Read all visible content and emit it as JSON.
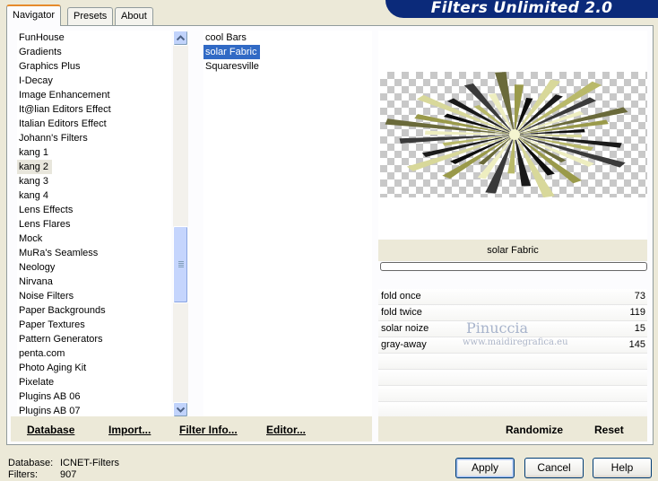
{
  "tabs": [
    {
      "label": "Navigator",
      "active": true
    },
    {
      "label": "Presets",
      "active": false
    },
    {
      "label": "About",
      "active": false
    }
  ],
  "banner": "Filters Unlimited 2.0",
  "categories": [
    "FunHouse",
    "Gradients",
    "Graphics Plus",
    "I-Decay",
    "Image Enhancement",
    "It@lian Editors Effect",
    "Italian Editors Effect",
    "Johann's Filters",
    "kang 1",
    "kang 2",
    "kang 3",
    "kang 4",
    "Lens Effects",
    "Lens Flares",
    "Mock",
    "MuRa's Seamless",
    "Neology",
    "Nirvana",
    "Noise Filters",
    "Paper Backgrounds",
    "Paper Textures",
    "Pattern Generators",
    "penta.com",
    "Photo Aging Kit",
    "Pixelate",
    "Plugins AB 06",
    "Plugins AB 07"
  ],
  "selected_category": "kang 2",
  "filters": [
    "cool Bars",
    "solar Fabric",
    "Squaresville"
  ],
  "selected_filter": "solar Fabric",
  "toolbar": {
    "database": "Database",
    "import": "Import...",
    "filter_info": "Filter Info...",
    "editor": "Editor...",
    "randomize": "Randomize",
    "reset": "Reset"
  },
  "preview_filter_name": "solar Fabric",
  "params": [
    {
      "label": "fold once",
      "value": "73"
    },
    {
      "label": "fold twice",
      "value": "119"
    },
    {
      "label": "solar noize",
      "value": "15"
    },
    {
      "label": "gray-away",
      "value": "145"
    }
  ],
  "watermark": {
    "title": "Pinuccia",
    "url": "www.maidiregrafica.eu"
  },
  "status": {
    "database_label": "Database:",
    "database_value": "ICNET-Filters",
    "filters_label": "Filters:",
    "filters_value": "907"
  },
  "buttons": {
    "apply": "Apply",
    "cancel": "Cancel",
    "help": "Help"
  }
}
